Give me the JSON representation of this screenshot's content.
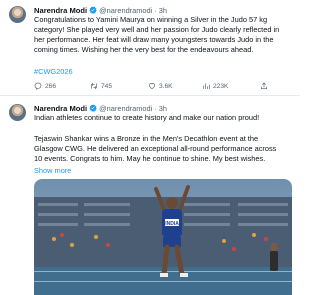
{
  "tweets": [
    {
      "author": "Narendra Modi",
      "handle": "@narendramodi",
      "separator": "·",
      "time": "3h",
      "lines": [
        "Congratulations to Yamini Maurya on winning a Silver in the Judo 57 kg",
        "category! She played very well and her passion for Judo clearly reflected in",
        "her performance. Her feat will draw many youngsters towards Judo in the",
        "coming times. Wishing her the very best for the endeavours ahead."
      ],
      "hashtag": "#CWG2026",
      "replies": "266",
      "retweets": "745",
      "likes": "3.6K",
      "views": "223K"
    },
    {
      "author": "Narendra Modi",
      "handle": "@narendramodi",
      "separator": "·",
      "time": "3h",
      "intro": "Indian athletes continue to create history and make our nation proud!",
      "body_lines": [
        "Tejaswin Shankar wins a Bronze in the Men's Decathlon event at the",
        "Glasgow CWG. He delivered an exceptional all-round performance across",
        "10 events. Congrats to him. May he continue to shine. My best wishes."
      ],
      "show_more": "Show more",
      "media_bib": "INDIA"
    }
  ],
  "colors": {
    "accent": "#1d9bf0",
    "muted": "#536471",
    "text": "#0f1419",
    "divider": "#e7e9ea"
  },
  "icons": [
    "reply-icon",
    "retweet-icon",
    "like-icon",
    "views-icon",
    "share-icon",
    "verified-icon"
  ]
}
